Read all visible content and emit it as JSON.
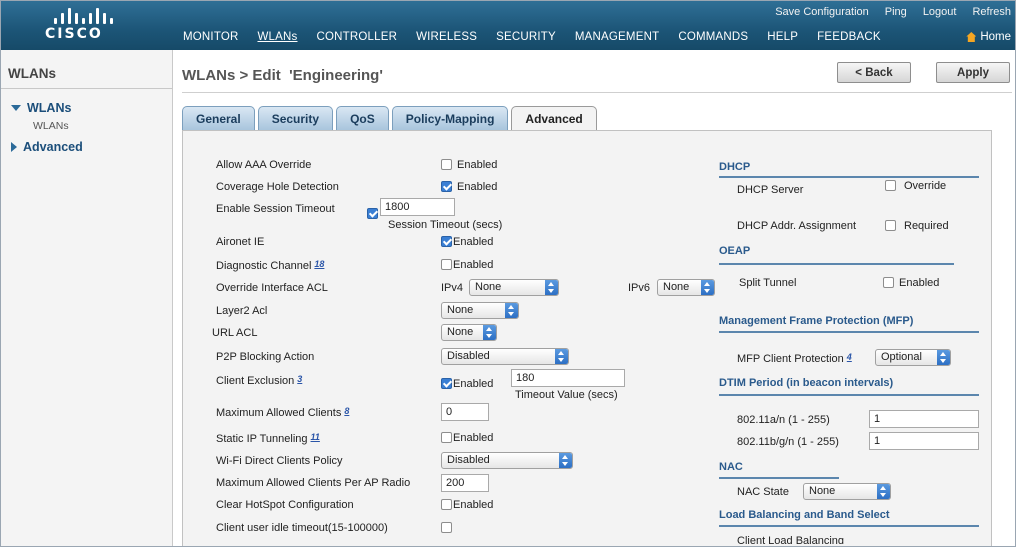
{
  "header": {
    "logo_word": "CISCO",
    "top_links": [
      "Save Configuration",
      "Ping",
      "Logout",
      "Refresh"
    ],
    "nav": [
      "MONITOR",
      "WLANs",
      "CONTROLLER",
      "WIRELESS",
      "SECURITY",
      "MANAGEMENT",
      "COMMANDS",
      "HELP",
      "FEEDBACK"
    ],
    "active_nav": "WLANs",
    "home_label": "Home"
  },
  "sidebar": {
    "title": "WLANs",
    "items": [
      {
        "label": "WLANs",
        "expanded": true,
        "sub": "WLANs"
      },
      {
        "label": "Advanced",
        "expanded": false
      }
    ]
  },
  "page": {
    "title": "WLANs > Edit  'Engineering'",
    "back_label": "< Back",
    "apply_label": "Apply"
  },
  "tabs": [
    "General",
    "Security",
    "QoS",
    "Policy-Mapping",
    "Advanced"
  ],
  "active_tab": "Advanced",
  "left": {
    "aaa_override": {
      "label": "Allow AAA Override",
      "check": "Enabled",
      "checked": false
    },
    "coverage_hole": {
      "label": "Coverage Hole Detection",
      "check": "Enabled",
      "checked": true
    },
    "session_timeout": {
      "label": "Enable Session Timeout",
      "checked": true,
      "value": "1800",
      "caption": "Session Timeout (secs)"
    },
    "aironet_ie": {
      "label": "Aironet IE",
      "check": "Enabled",
      "checked": true
    },
    "diag_channel": {
      "label": "Diagnostic Channel",
      "note": "18",
      "check": "Enabled",
      "checked": false
    },
    "override_acl": {
      "label": "Override Interface ACL",
      "ipv4_label": "IPv4",
      "ipv4_value": "None",
      "ipv6_label": "IPv6",
      "ipv6_value": "None"
    },
    "layer2_acl": {
      "label": "Layer2 Acl",
      "value": "None"
    },
    "url_acl": {
      "label": "URL ACL",
      "value": "None"
    },
    "p2p_blocking": {
      "label": "P2P Blocking Action",
      "value": "Disabled"
    },
    "client_exclusion": {
      "label": "Client Exclusion",
      "note": "3",
      "check": "Enabled",
      "checked": true,
      "value": "180",
      "caption": "Timeout Value (secs)"
    },
    "max_clients": {
      "label": "Maximum Allowed Clients",
      "note": "8",
      "value": "0"
    },
    "static_ip": {
      "label": "Static IP Tunneling",
      "note": "11",
      "check": "Enabled",
      "checked": false
    },
    "wifi_direct": {
      "label": "Wi-Fi Direct Clients Policy",
      "value": "Disabled"
    },
    "max_per_radio": {
      "label": "Maximum Allowed Clients Per AP Radio",
      "value": "200"
    },
    "clear_hotspot": {
      "label": "Clear HotSpot Configuration",
      "check": "Enabled",
      "checked": false
    },
    "idle_timeout": {
      "label": "Client user idle timeout(15-100000)",
      "checked": false
    }
  },
  "right": {
    "dhcp": {
      "title": "DHCP",
      "server_label": "DHCP Server",
      "server_check": "Override",
      "assign_label": "DHCP Addr. Assignment",
      "assign_check": "Required"
    },
    "oeap": {
      "title": "OEAP",
      "split_label": "Split Tunnel",
      "split_check": "Enabled"
    },
    "mfp": {
      "title": "Management Frame Protection (MFP)",
      "label": "MFP Client Protection",
      "note": "4",
      "value": "Optional"
    },
    "dtim": {
      "title": "DTIM Period (in beacon intervals)",
      "a_label": "802.11a/n (1 - 255)",
      "a_value": "1",
      "b_label": "802.11b/g/n (1 - 255)",
      "b_value": "1"
    },
    "nac": {
      "title": "NAC",
      "label": "NAC State",
      "value": "None"
    },
    "lb": {
      "title": "Load Balancing and Band Select",
      "partial": "Client Load Balancing"
    }
  },
  "colors": {
    "header": "#1c5577",
    "tab": "#a9c5dd",
    "section": "#2a5a8c",
    "checkbox": "#3a7fd4"
  }
}
